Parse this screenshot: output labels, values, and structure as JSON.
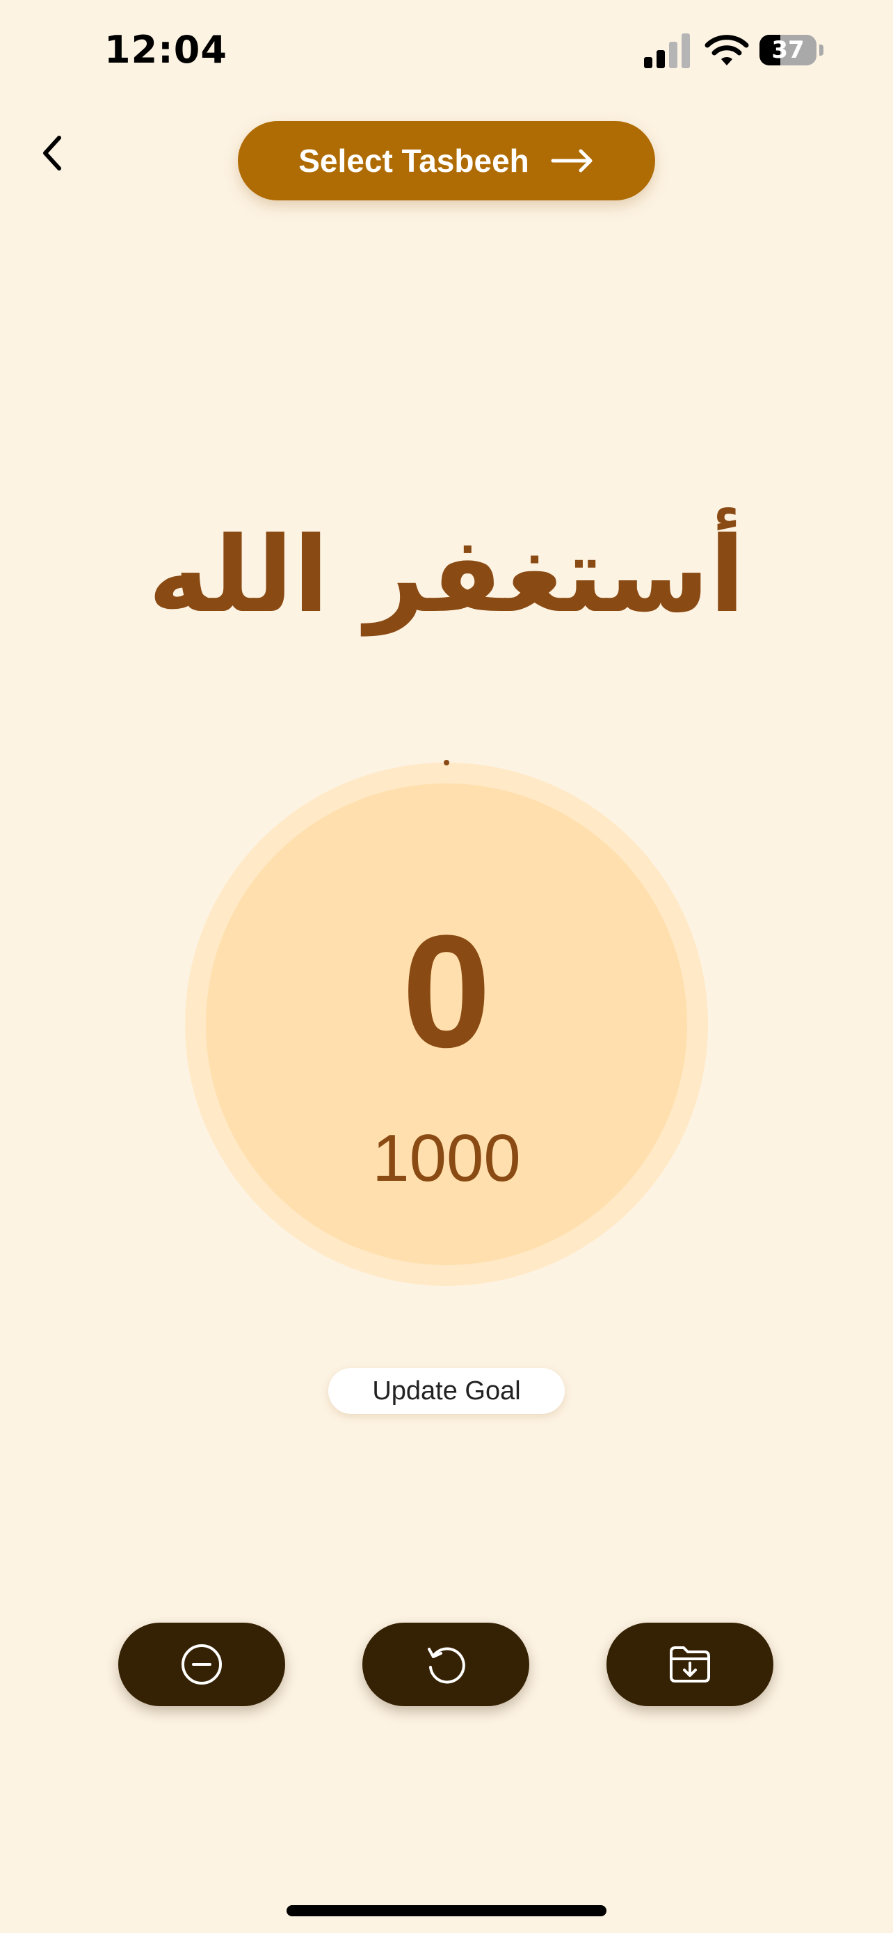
{
  "status_bar": {
    "time": "12:04",
    "battery_percent": "37",
    "battery_level": 0.37,
    "icons": [
      "cellular-signal-icon",
      "wifi-icon",
      "battery-icon"
    ]
  },
  "header": {
    "back_icon": "chevron-left-icon",
    "select_tasbeeh_label": "Select Tasbeeh",
    "select_tasbeeh_icon": "arrow-right-icon"
  },
  "tasbeeh": {
    "arabic_text": "أستغفر الله"
  },
  "counter": {
    "count": "0",
    "goal": "1000"
  },
  "update_goal_label": "Update Goal",
  "actions": [
    {
      "name": "decrement",
      "icon": "minus-circle-icon"
    },
    {
      "name": "reset",
      "icon": "reset-icon"
    },
    {
      "name": "save",
      "icon": "folder-download-icon"
    }
  ],
  "colors": {
    "background": "#fdf3e3",
    "accent": "#b06c04",
    "text_brown": "#8a4a13",
    "counter_ring": "#ffe9c6",
    "counter_fill": "#ffdfad",
    "action_button": "#352103"
  }
}
